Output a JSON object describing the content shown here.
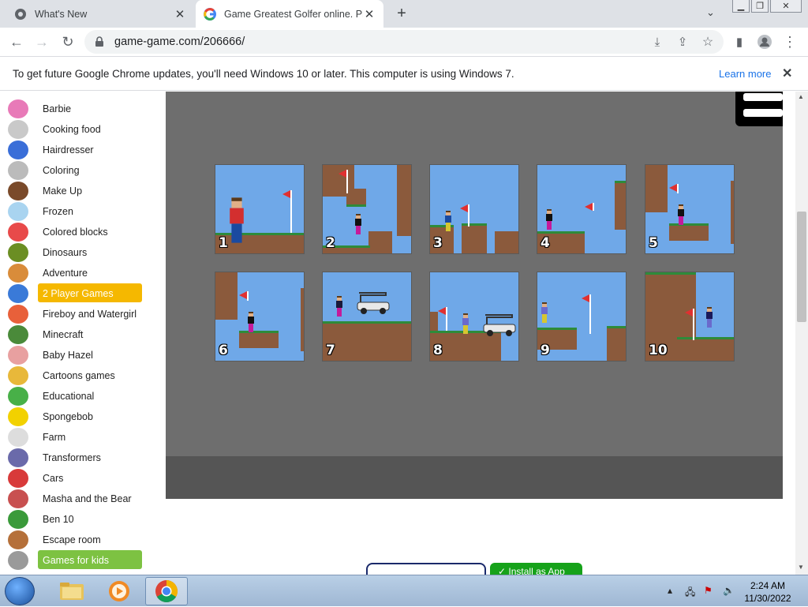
{
  "tabs": [
    {
      "title": "What's New",
      "icon": "chrome-settings-icon"
    },
    {
      "title": "Game Greatest Golfer online. Pla",
      "icon": "google-icon",
      "active": true
    }
  ],
  "toolbar": {
    "url": "game-game.com/206666/"
  },
  "infobar": {
    "message": "To get future Google Chrome updates, you'll need Windows 10 or later. This computer is using Windows 7.",
    "learn_more": "Learn more"
  },
  "sidebar": {
    "items": [
      {
        "label": "Barbie",
        "icon": "barbie-icon"
      },
      {
        "label": "Cooking food",
        "icon": "chef-icon"
      },
      {
        "label": "Hairdresser",
        "icon": "scissors-icon"
      },
      {
        "label": "Coloring",
        "icon": "coloring-icon"
      },
      {
        "label": "Make Up",
        "icon": "makeup-icon"
      },
      {
        "label": "Frozen",
        "icon": "elsa-icon"
      },
      {
        "label": "Colored blocks",
        "icon": "blocks-icon"
      },
      {
        "label": "Dinosaurs",
        "icon": "dinosaur-icon"
      },
      {
        "label": "Adventure",
        "icon": "adventure-icon"
      },
      {
        "label": "2 Player Games",
        "icon": "two-player-icon",
        "highlight": "#f5b800"
      },
      {
        "label": "Fireboy and Watergirl",
        "icon": "fireboy-icon"
      },
      {
        "label": "Minecraft",
        "icon": "minecraft-icon"
      },
      {
        "label": "Baby Hazel",
        "icon": "baby-hazel-icon"
      },
      {
        "label": "Cartoons games",
        "icon": "cartoon-icon"
      },
      {
        "label": "Educational",
        "icon": "educational-icon"
      },
      {
        "label": "Spongebob",
        "icon": "spongebob-icon"
      },
      {
        "label": "Farm",
        "icon": "farm-icon"
      },
      {
        "label": "Transformers",
        "icon": "transformers-icon"
      },
      {
        "label": "Cars",
        "icon": "cars-icon"
      },
      {
        "label": "Masha and the Bear",
        "icon": "masha-icon"
      },
      {
        "label": "Ben 10",
        "icon": "ben10-icon"
      },
      {
        "label": "Escape room",
        "icon": "door-icon"
      },
      {
        "label": "Games for kids",
        "icon": "kids-icon",
        "highlight": "#7dc242"
      }
    ]
  },
  "levels": [
    "1",
    "2",
    "3",
    "4",
    "5",
    "6",
    "7",
    "8",
    "9",
    "10"
  ],
  "bottom_buttons": {
    "install": "✓ Install as App"
  },
  "taskbar": {
    "apps": [
      "file-explorer-icon",
      "media-player-icon",
      "chrome-icon"
    ],
    "time": "2:24 AM",
    "date": "11/30/2022"
  },
  "colors": {
    "game_bg": "#6e6e6e",
    "sky": "#6fa8e8",
    "dirt": "#8b5a3c",
    "grass": "#2e8b3a",
    "flag": "#e03030"
  }
}
